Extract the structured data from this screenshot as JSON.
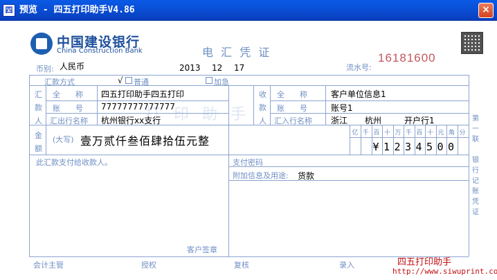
{
  "window": {
    "title": "预览 - 四五打印助手V4.86",
    "close_label": "×"
  },
  "header": {
    "bank_name_cn": "中国建设银行",
    "bank_name_en": "China Construction Bank",
    "doc_title": "电 汇 凭 证",
    "serial_label": "流水号:",
    "serial_number": "16181600"
  },
  "form": {
    "currency_label": "币别:",
    "currency": "人民币",
    "date": {
      "year": "2013",
      "month": "12",
      "day": "17"
    },
    "remit_method_label": "汇款方式",
    "method_normal_label": "普通",
    "method_normal_check": "√",
    "method_urgent_label": "加急",
    "remitter": {
      "side_label": [
        "汇",
        "款",
        "人"
      ],
      "name_label": "全　　称",
      "account_label": "账　　号",
      "bank_label": "汇出行名称",
      "name": "四五打印助手四五打印",
      "account": "77777777777777",
      "bank": "杭州银行xx支行"
    },
    "payee": {
      "side_label": [
        "收",
        "款",
        "人"
      ],
      "name_label": "全　　称",
      "account_label": "账　　号",
      "bank_label": "汇入行名称",
      "name": "客户单位信息1",
      "account": "账号1",
      "province": "浙江",
      "city": "杭州",
      "bank": "开户行1"
    },
    "amount_label": [
      "金",
      "额"
    ],
    "amount_caps_label": "(大写)",
    "amount_caps": "壹万贰仟叁佰肆拾伍元整",
    "amount_units": [
      "亿",
      "千",
      "百",
      "十",
      "万",
      "千",
      "百",
      "十",
      "元",
      "角",
      "分"
    ],
    "amount_digits": [
      "",
      "",
      "¥",
      "1",
      "2",
      "3",
      "4",
      "5",
      "0",
      "0",
      ""
    ],
    "payment_note": "此汇款支付给收款人。",
    "pay_password_label": "支付密码",
    "extra_info_label": "附加信息及用途:",
    "extra_info": "货款",
    "customer_sign_label": "客户签章",
    "side_note": [
      "第",
      "一",
      "联",
      "",
      "银",
      "行",
      "记",
      "账",
      "凭",
      "证"
    ]
  },
  "footer": {
    "supervisor_label": "会计主管",
    "authorize_label": "授权",
    "review_label": "复核",
    "entry_label": "录入",
    "brand": "四五打印助手",
    "url": "http://www.siwuprint.com"
  },
  "watermark": "打 印 助 手",
  "colors": {
    "titlebar": "#0a4fd6",
    "form_lines": "#8ca4cf",
    "labels": "#6e8fc4",
    "serial": "#c4565f",
    "brand": "#c01010"
  }
}
